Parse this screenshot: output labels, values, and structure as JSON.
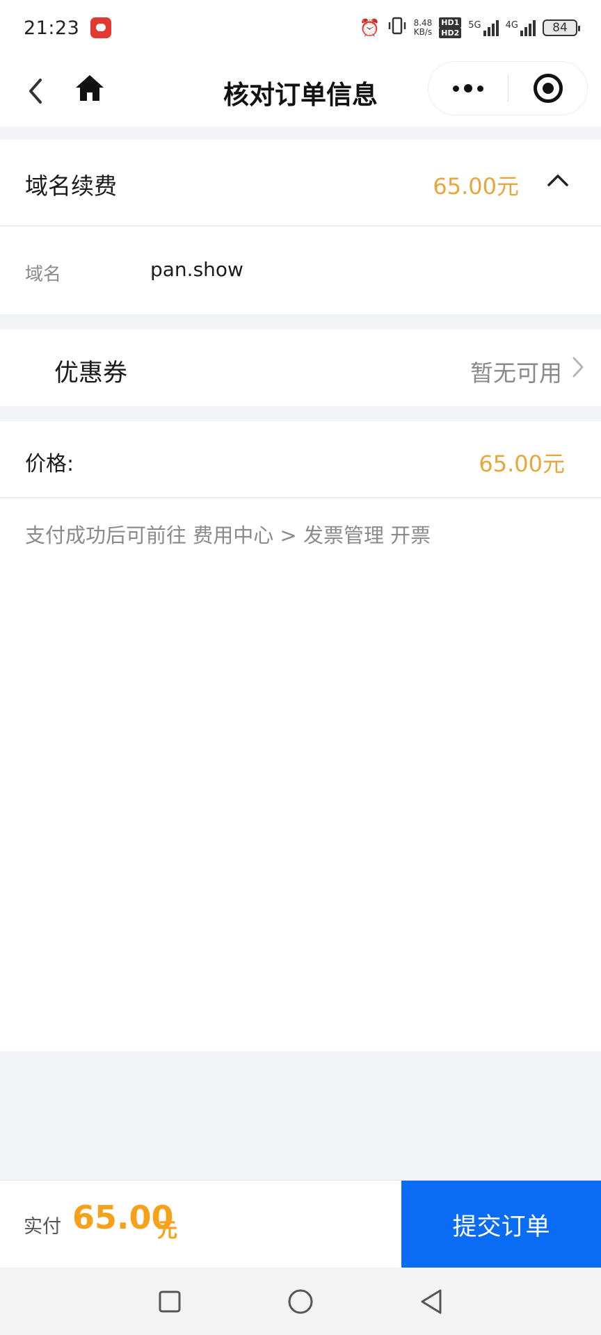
{
  "status_bar": {
    "time": "21:23",
    "net_speed_value": "8.48",
    "net_speed_unit": "KB/s",
    "hd1": "HD1",
    "hd2": "HD2",
    "net1": "5G",
    "net2": "4G",
    "battery": "84",
    "icons": [
      "app-icon",
      "alarm-icon",
      "vibrate-icon",
      "signal-icon",
      "battery-icon"
    ]
  },
  "nav": {
    "title": "核对订单信息",
    "icons": [
      "back-arrow-icon",
      "home-icon",
      "more-dots-icon",
      "target-close-icon"
    ]
  },
  "order": {
    "product_label": "域名续费",
    "product_price": "65.00元",
    "domain_label": "域名",
    "domain_value": "pan.show"
  },
  "coupon": {
    "label": "优惠券",
    "value": "暂无可用"
  },
  "price": {
    "label": "价格:",
    "value": "65.00元"
  },
  "note": "支付成功后可前往 费用中心 > 发票管理 开票",
  "footer": {
    "pay_label": "实付",
    "pay_amount": "65.00",
    "pay_unit": "元",
    "submit_label": "提交订单"
  },
  "colors": {
    "accent_orange": "#e9a63a",
    "pay_orange": "#f7a11a",
    "submit_blue": "#0a6cf5",
    "page_bg": "#f3f4f8"
  }
}
